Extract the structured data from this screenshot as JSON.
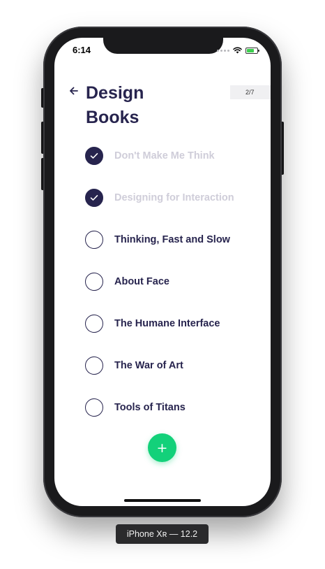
{
  "status_bar": {
    "time": "6:14",
    "icons": [
      "signal-dots-icon",
      "wifi-icon",
      "battery-charging-icon"
    ]
  },
  "header": {
    "back_icon": "arrow-left-icon",
    "title_line1": "Design",
    "title_line2": "Books",
    "page_badge": "2/7"
  },
  "books": [
    {
      "title": "Don't Make Me Think",
      "checked": true
    },
    {
      "title": "Designing for Interaction",
      "checked": true
    },
    {
      "title": "Thinking, Fast and Slow",
      "checked": false
    },
    {
      "title": "About Face",
      "checked": false
    },
    {
      "title": "The Humane Interface",
      "checked": false
    },
    {
      "title": "The War of Art",
      "checked": false
    },
    {
      "title": "Tools of Titans",
      "checked": false
    }
  ],
  "fab": {
    "label": "+",
    "icon": "plus-icon"
  },
  "device_label": "iPhone Xʀ — 12.2",
  "colors": {
    "primary": "#27244e",
    "done_text": "#cfcdd9",
    "accent": "#13d17a"
  }
}
